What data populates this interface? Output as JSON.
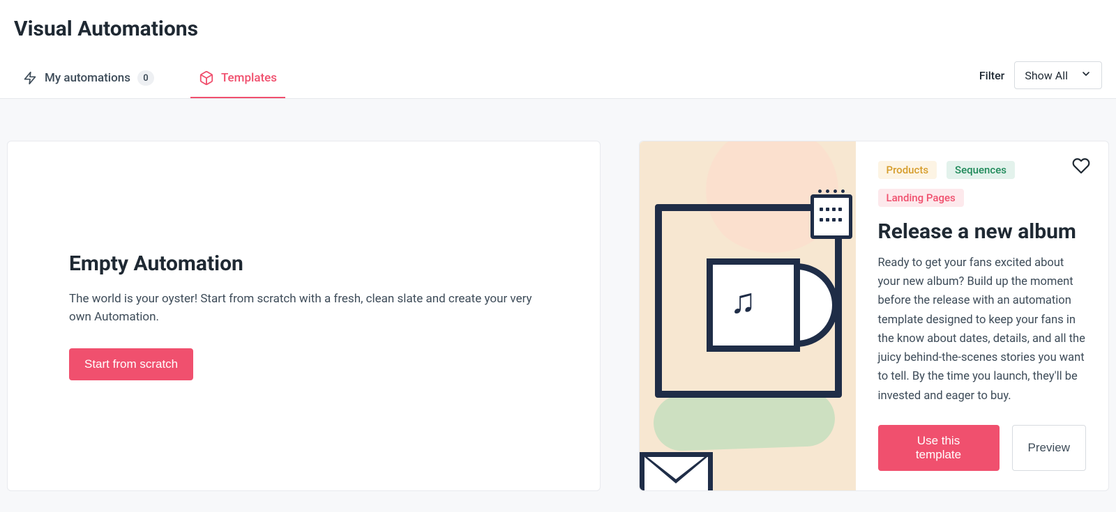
{
  "page_title": "Visual Automations",
  "tabs": {
    "my_automations_label": "My automations",
    "my_automations_count": "0",
    "templates_label": "Templates"
  },
  "filter": {
    "label": "Filter",
    "selected": "Show All"
  },
  "empty_card": {
    "title": "Empty Automation",
    "description": "The world is your oyster! Start from scratch with a fresh, clean slate and create your very own Automation.",
    "cta": "Start from scratch"
  },
  "template_card": {
    "tags": {
      "products": "Products",
      "sequences": "Sequences",
      "landing": "Landing Pages"
    },
    "title": "Release a new album",
    "description": "Ready to get your fans excited about your new album? Build up the moment before the release with an automation template designed to keep your fans in the know about dates, details, and all the juicy behind-the-scenes stories you want to tell. By the time you launch, they'll be invested and eager to buy.",
    "use_cta": "Use this template",
    "preview_cta": "Preview"
  }
}
